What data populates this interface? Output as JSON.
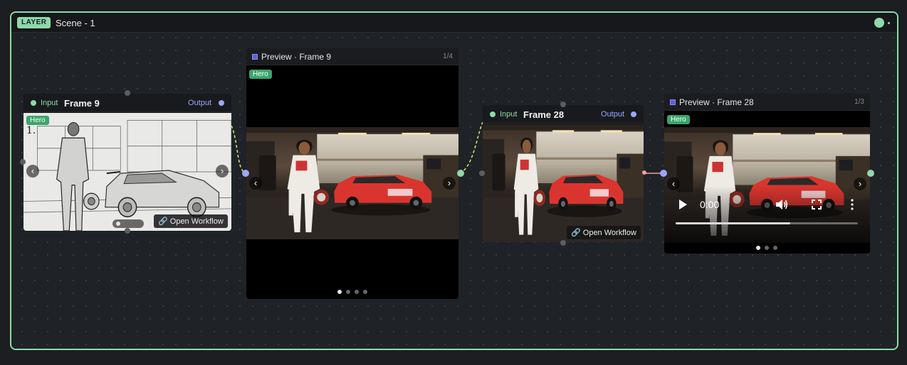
{
  "layer": {
    "badge": "LAYER",
    "title": "Scene - 1"
  },
  "colors": {
    "accent": "#8fd9a8",
    "output": "#9aa7ff",
    "hero": "#3aa56b"
  },
  "nodes": {
    "frame9": {
      "input_label": "Input",
      "title": "Frame 9",
      "output_label": "Output",
      "hero": "Hero",
      "step": "1.",
      "open_workflow": "Open Workflow",
      "image_style": "pencil sketch"
    },
    "preview9": {
      "title": "Preview · Frame 9",
      "count": "1/4",
      "hero": "Hero"
    },
    "frame28": {
      "input_label": "Input",
      "title": "Frame 28",
      "output_label": "Output",
      "open_workflow": "Open Workflow"
    },
    "preview28": {
      "title": "Preview · Frame 28",
      "count": "1/3",
      "hero": "Hero",
      "time": "0:00",
      "progress": 0.63
    }
  },
  "icons": {
    "link": "link-icon",
    "play": "play-icon",
    "volume": "volume-icon",
    "fullscreen": "fullscreen-icon",
    "more": "more-vertical-icon",
    "prev": "chevron-left-icon",
    "next": "chevron-right-icon"
  }
}
